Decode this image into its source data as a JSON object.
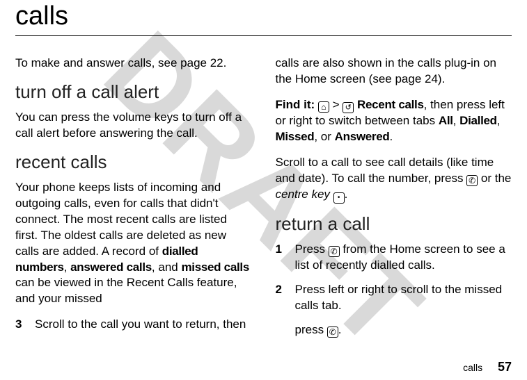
{
  "watermark": "DRAFT",
  "title": "calls",
  "left": {
    "intro": "To make and answer calls, see page 22.",
    "section1": "turn off a call alert",
    "p1": "You can press the volume keys to turn off a call alert before answering the call.",
    "section2": "recent calls",
    "p2a": "Your phone keeps lists of incoming and outgoing calls, even for calls that didn't connect. The most recent calls are listed first. The oldest calls are deleted as new calls are added. A record of ",
    "p2_dialled": "dialled numbers",
    "p2b": ", ",
    "p2_answered": "answered calls",
    "p2c": ", and ",
    "p2_missed": "missed calls",
    "p2d": " can be viewed in the Recent Calls feature, and your missed ",
    "step3_num": "3",
    "step3_txt": "Scroll to the call you want to return, then"
  },
  "right": {
    "p1": "calls are also shown in the calls plug-in on the Home screen (see page 24).",
    "find_label": "Find it:",
    "find_a": " > ",
    "find_recent": "Recent calls",
    "find_b": ", then press left or right to switch between tabs ",
    "tab_all": "All",
    "sep1": ", ",
    "tab_dialled": "Dialled",
    "sep2": ", ",
    "tab_missed": "Missed",
    "sep3": ", or ",
    "tab_answered": "Answered",
    "sep4": ".",
    "p3a": "Scroll to a call to see call details (like time and date). To call the number, press ",
    "p3b": " or the ",
    "p3_centre": "centre key",
    "p3c": " ",
    "p3d": ".",
    "section3": "return a call",
    "step1_num": "1",
    "step1_a": "Press ",
    "step1_b": " from the Home screen to see a list of recently dialled calls.",
    "step2_num": "2",
    "step2_txt": "Press left or right to scroll to the missed calls tab.",
    "extra_a": "press ",
    "extra_b": "."
  },
  "footer": {
    "label": "calls",
    "page": "57"
  }
}
